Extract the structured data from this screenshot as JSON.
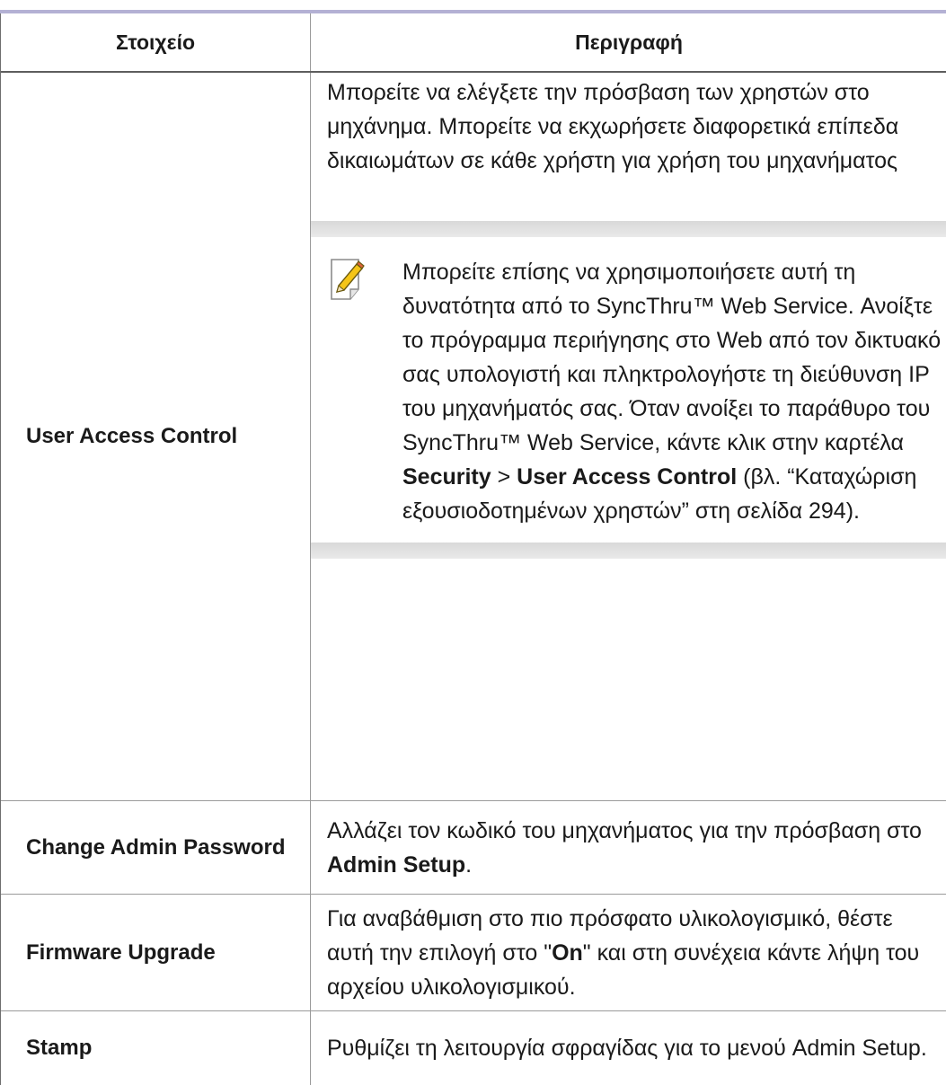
{
  "table": {
    "headers": {
      "item": "Στοιχείο",
      "description": "Περιγραφή"
    },
    "user_access_control": {
      "item": "User Access Control",
      "description": "Μπορείτε να ελέγξετε την πρόσβαση των χρηστών στο μηχάνημα. Μπορείτε να εκχωρήσετε διαφορετικά επίπεδα δικαιωμάτων σε κάθε χρήστη για χρήση του μηχανήματος",
      "note": {
        "icon": "note-pencil-icon",
        "text_before": "Μπορείτε επίσης να χρησιμοποιήσετε αυτή τη δυνατότητα από το SyncThru™ Web Service. Ανοίξτε το πρόγραμμα περιήγησης στο Web από τον δικτυακό σας υπολογιστή και πληκτρολογήστε τη διεύθυνση IP του μηχανήματός σας. Όταν ανοίξει το παράθυρο του SyncThru™ Web Service, κάντε κλικ στην καρτέλα ",
        "bold_1": "Security",
        "sep": " > ",
        "bold_2": "User Access Control",
        "text_after": " (βλ. “Καταχώριση εξουσιοδοτημένων χρηστών” στη σελίδα 294)."
      }
    },
    "change_admin_password": {
      "item": "Change Admin Password",
      "desc_before": "Αλλάζει τον κωδικό του μηχανήματος για την πρόσβαση στο ",
      "desc_bold": "Admin Setup",
      "desc_after": "."
    },
    "firmware_upgrade": {
      "item": "Firmware Upgrade",
      "desc_before": "Για αναβάθμιση στο πιο πρόσφατο υλικολογισμικό, θέστε αυτή την επιλογή στο \"",
      "desc_bold": "On",
      "desc_after": "\" και στη συνέχεια κάντε λήψη του αρχείου υλικολογισμικού."
    },
    "stamp": {
      "item": "Stamp",
      "description": "Ρυθμίζει τη λειτουργία σφραγίδας για το μενού Admin Setup."
    }
  }
}
